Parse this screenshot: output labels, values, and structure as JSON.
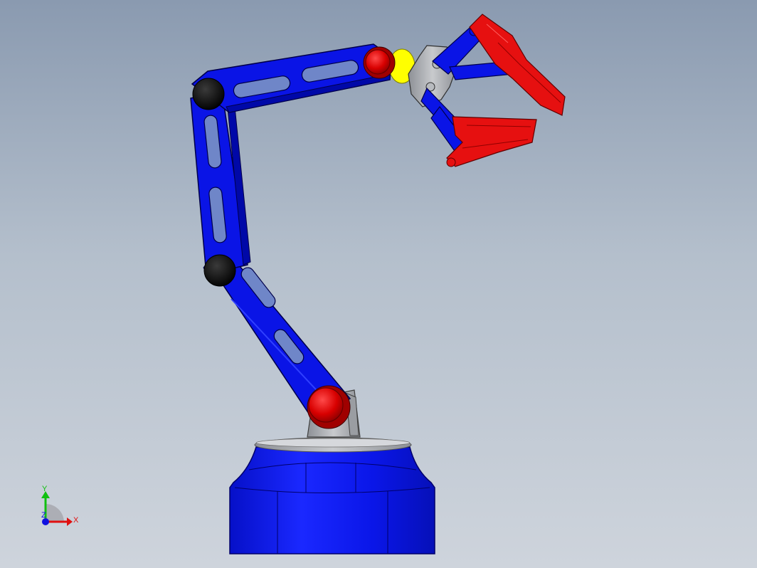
{
  "view": {
    "background_top": "#8a9ab0",
    "background_bottom": "#ced4dc"
  },
  "model": {
    "arm_color": "#0a14e6",
    "joint_red": "#e00000",
    "joint_black": "#0a0a0a",
    "gripper_red": "#e61010",
    "bracket_gray": "#a8abb0",
    "wrist_yellow": "#ffff00"
  },
  "triad": {
    "x_label": "X",
    "y_label": "Y",
    "z_label": "Z",
    "x_color": "#e01010",
    "y_color": "#10c010",
    "z_color": "#1010e0"
  }
}
